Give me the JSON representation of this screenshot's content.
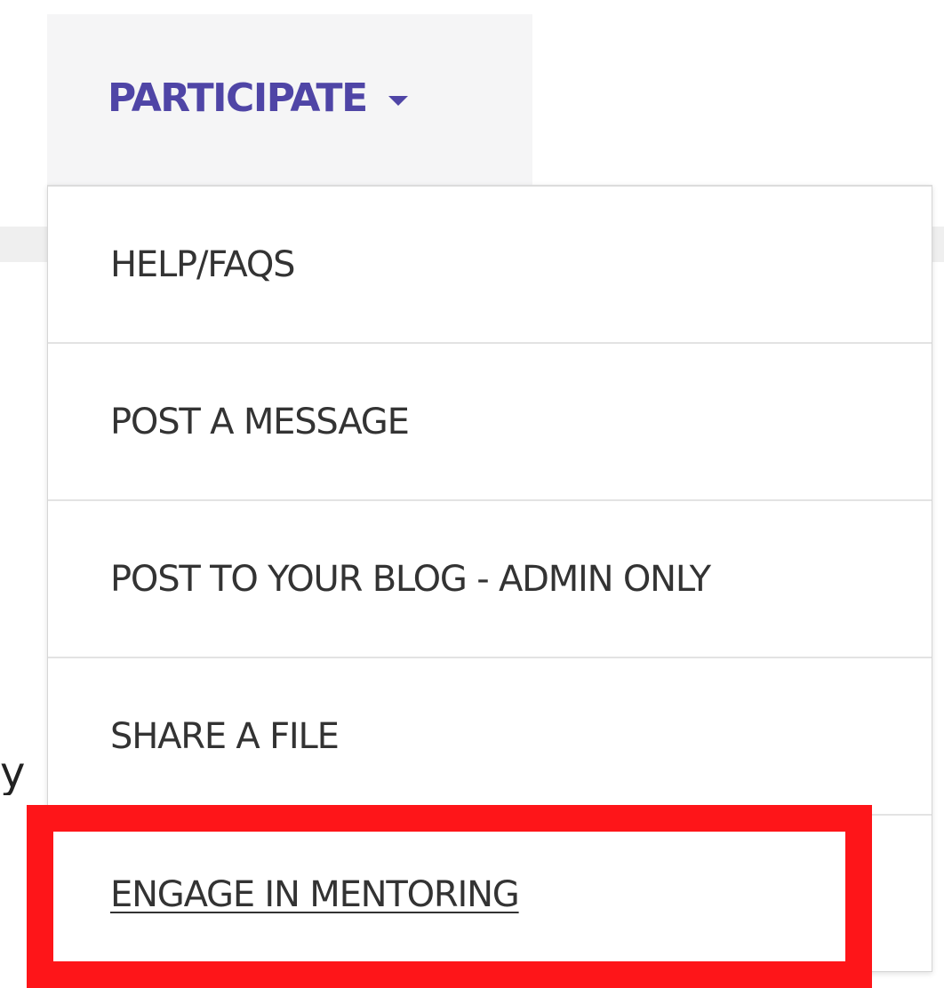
{
  "page": {
    "partial_text_fragment": "y"
  },
  "nav": {
    "participate_tab": {
      "label": "PARTICIPATE",
      "icon": "caret-down-icon",
      "color": "#4f45a6",
      "expanded": true
    }
  },
  "dropdown": {
    "items": [
      {
        "label": "HELP/FAQS"
      },
      {
        "label": "POST A MESSAGE"
      },
      {
        "label": "POST TO YOUR BLOG - ADMIN ONLY"
      },
      {
        "label": "SHARE A FILE"
      },
      {
        "label": "ENGAGE IN MENTORING",
        "hovered": true
      }
    ]
  },
  "annotation": {
    "highlight_color": "#fe1519",
    "highlighted_item": "ENGAGE IN MENTORING"
  }
}
